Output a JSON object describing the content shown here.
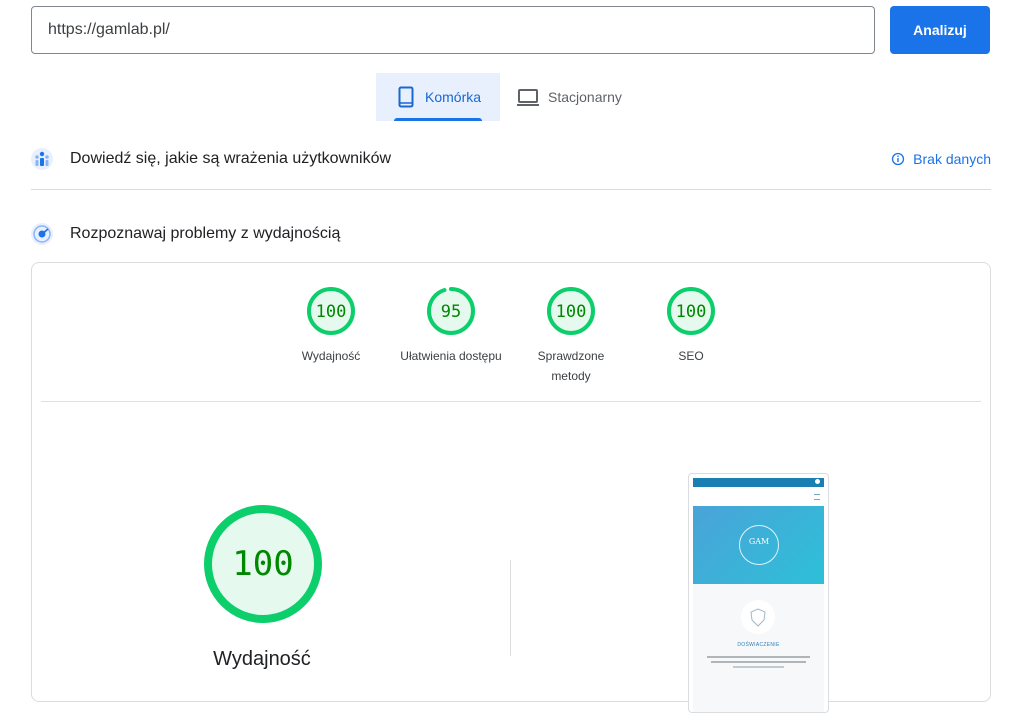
{
  "search": {
    "url_value": "https://gamlab.pl/",
    "analyze_label": "Analizuj"
  },
  "tabs": [
    {
      "label": "Komórka",
      "icon": "smartphone-icon",
      "active": true
    },
    {
      "label": "Stacjonarny",
      "icon": "laptop-icon",
      "active": false
    }
  ],
  "field_data": {
    "title": "Dowiedź się, jakie są wrażenia użytkowników",
    "status": "Brak danych",
    "status_icon": "info-icon"
  },
  "lab_data": {
    "title": "Rozpoznawaj problemy z wydajnością"
  },
  "scores": [
    {
      "value": 100,
      "label": "Wydajność"
    },
    {
      "value": 95,
      "label": "Ułatwienia dostępu"
    },
    {
      "value": 100,
      "label": "Sprawdzone metody"
    },
    {
      "value": 100,
      "label": "SEO"
    }
  ],
  "main_score": {
    "value": "100",
    "label": "Wydajność"
  },
  "screenshot": {
    "heading": "DOŚWIACZENIE",
    "logo_text": "GAM"
  },
  "colors": {
    "accent": "#1a73e8",
    "pass": "#0cce6b",
    "pass_bg": "#e6f9ee",
    "pass_text": "#008800"
  }
}
